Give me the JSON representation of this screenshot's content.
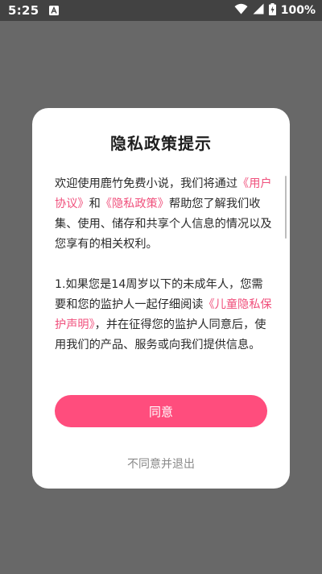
{
  "status_bar": {
    "time": "5:25",
    "battery_percent": "100%",
    "icons": [
      "notification-a-icon",
      "wifi-icon",
      "signal-icon",
      "battery-charging-icon"
    ]
  },
  "dialog": {
    "title": "隐私政策提示",
    "paragraph1": {
      "t1": "欢迎使用鹿竹免费小说，我们将通过",
      "link1": "《用户协议》",
      "t2": "和",
      "link2": "《隐私政策》",
      "t3": "帮助您了解我们收集、使用、储存和共享个人信息的情况以及您享有的相关权利。"
    },
    "paragraph2": {
      "t1": "1.如果您是14周岁以下的未成年人，您需要和您的监护人一起仔细阅读",
      "link1": "《儿童隐私保护声明》",
      "t2": "，并在征得您的监护人同意后，使用我们的产品、服务或向我们提供信息。"
    },
    "agree_label": "同意",
    "disagree_label": "不同意并退出"
  },
  "colors": {
    "accent": "#ff4d7d",
    "link": "#f0507c",
    "overlay": "#686868",
    "status_bar": "#424242"
  }
}
